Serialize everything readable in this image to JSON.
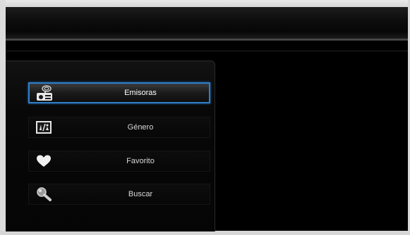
{
  "menu": {
    "items": [
      {
        "label": "Emisoras",
        "icon": "radio-icon",
        "selected": true
      },
      {
        "label": "Género",
        "icon": "genre-icon",
        "selected": false
      },
      {
        "label": "Favorito",
        "icon": "heart-icon",
        "selected": false
      },
      {
        "label": "Buscar",
        "icon": "magnifier-icon",
        "selected": false
      }
    ]
  },
  "colors": {
    "selection_border": "#2f7fc9",
    "background": "#000000",
    "text": "#d8d8d8"
  }
}
